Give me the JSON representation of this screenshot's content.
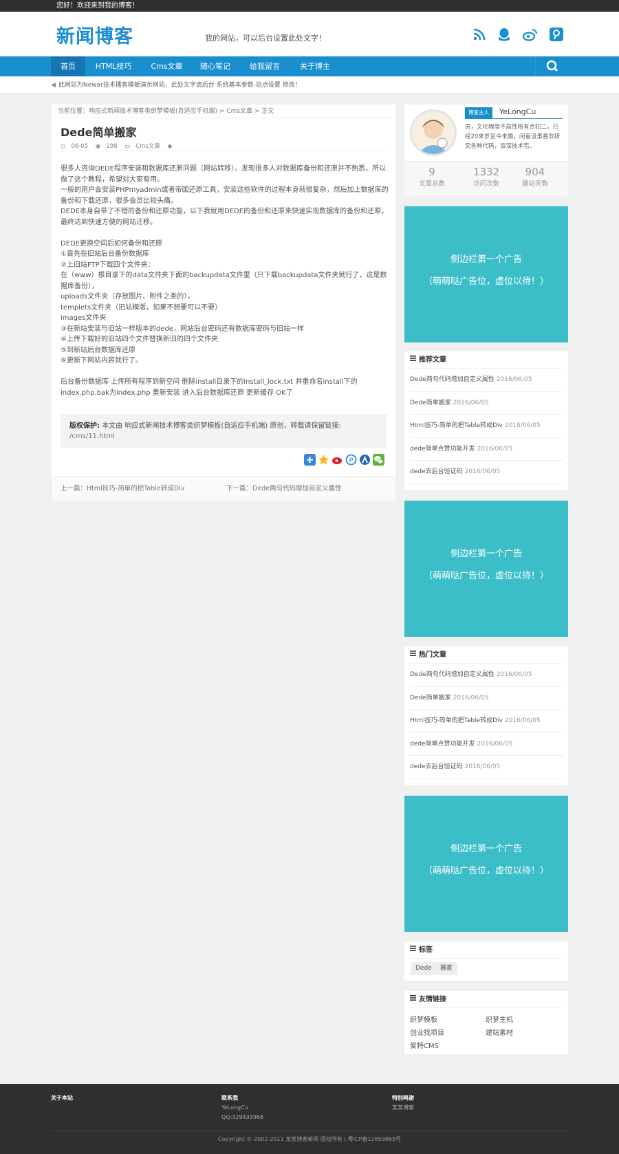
{
  "topbar": {
    "welcome": "您好！欢迎来到我的博客！"
  },
  "header": {
    "logo": "新闻博客",
    "slogan": "我的网站，可以后台设置此处文字！",
    "icons": [
      "rss-icon",
      "qq-icon",
      "weibo-icon",
      "pinterest-icon"
    ]
  },
  "nav": {
    "items": [
      "首页",
      "HTML技巧",
      "Cms文章",
      "随心笔记",
      "给我留言",
      "关于博主"
    ],
    "active": "首页"
  },
  "notice": "此网站为Newar技术播客模板演示网站，此处文字请后台 系统基本参数-站点设置 修改！",
  "article": {
    "breadcrumb": "当前位置：响应式新闻技术博客类织梦模板(自适应手机端) > Cms文章 > 正文",
    "title": "Dede简单搬家",
    "date": "06-05",
    "views": "198",
    "category": "Cms文章",
    "paragraphs": [
      "很多人咨询DEDE程序安装和数据库还原问题（网站转移）。发现很多人对数据库备份和还原并不熟悉，所以做了这个教程，希望对大家有用。",
      "一般的用户会安装PHPmyadmin或者帝国还原工具，安装这些软件的过程本身就很复杂，然后加上数据库的备份和下载还原，很多会员比较头痛。",
      "DEDE本身自带了不错的备份和还原功能，以下我就用DEDE的备份和还原来快速实现数据库的备份和还原，最终达到快速方便的网站迁移。",
      "",
      "DEDE更换空间后如何备份和还原",
      "①首先在旧站后台备份数据库",
      "②上旧站FTP下载四个文件夹：",
      "在（www）根目录下的data文件夹下面的backupdata文件里（只下载backupdata文件夹就行了，这是数据库备份），",
      "uploads文件夹（存放图片、附件之类的），",
      "templets文件夹（旧站模版，如果不想要可以不要）",
      "images文件夹",
      "③在新站安装与旧站一样版本的dede，网站后台密码还有数据库密码与旧站一样",
      "④上传下载好的旧站四个文件替换新旧的四个文件夹",
      "⑤到新站后台数据库还原",
      "⑥更新下网站内容就行了。",
      "",
      "后台备份数据库 上传所有程序到新空间 删除install目录下的install_lock.txt 并重命名install下的index.php.bak为index.php 重新安装 进入后台数据库还原 更新缓存 OK了"
    ],
    "copyright_label": "版权保护:",
    "copyright_text": "本文由 响应式新闻技术博客类织梦模板(自适应手机端) 原创，转载请保留链接:",
    "copyright_link": "/cms/11.html",
    "prev": "上一篇：Html技巧-简单的把Table转成Div",
    "next": "下一篇：Dede两句代码增加自定义属性"
  },
  "profile": {
    "badge": "博客主人",
    "name": "YeLongCu",
    "bio": "男，文化程度不高性格有点犯二，已经20来岁至今未婚，闲着没事喜欢研究各种代码，资深技术宅。",
    "stats": [
      {
        "value": "9",
        "label": "文章总数"
      },
      {
        "value": "1332",
        "label": "访问次数"
      },
      {
        "value": "904",
        "label": "建站天数"
      }
    ]
  },
  "ad": {
    "line1": "侧边栏第一个广告",
    "line2": "（萌萌哒广告位，虚位以待！）"
  },
  "recommended": {
    "title": "推荐文章",
    "items": [
      {
        "text": "Dede两句代码增加自定义属性",
        "date": "2016/06/05"
      },
      {
        "text": "Dede简单搬家",
        "date": "2016/06/05"
      },
      {
        "text": "Html技巧-简单的把Table转成Div",
        "date": "2016/06/05"
      },
      {
        "text": "dede简单点赞功能开发",
        "date": "2016/06/05"
      },
      {
        "text": "dede去后台验证码",
        "date": "2016/06/05"
      }
    ]
  },
  "hot": {
    "title": "热门文章",
    "items": [
      {
        "text": "Dede两句代码增加自定义属性",
        "date": "2016/06/05"
      },
      {
        "text": "Dede简单搬家",
        "date": "2016/06/05"
      },
      {
        "text": "Html技巧-简单的把Table转成Div",
        "date": "2016/06/05"
      },
      {
        "text": "dede简单点赞功能开发",
        "date": "2016/06/05"
      },
      {
        "text": "dede去后台验证码",
        "date": "2016/06/05"
      }
    ]
  },
  "tags": {
    "title": "标签",
    "items": [
      "Dede",
      "搬家"
    ]
  },
  "links": {
    "title": "友情链接",
    "items": [
      "织梦模板",
      "织梦主机",
      "创业找项目",
      "建站素材",
      "爱特CMS"
    ]
  },
  "footer": {
    "about": "关于本站",
    "contact": "联系我",
    "contact_name": "YeLongCu",
    "contact_qq": "QQ:329439966",
    "thanks": "特别鸣谢",
    "thanks_item": "某某博客",
    "copyright": "Copyright © 2002-2011 某某博客新闻 版权所有 | 粤ICP备12659865号"
  },
  "colors": {
    "brand": "#1a8fd0",
    "ad": "#3bbec8",
    "dark": "#2f2f2f"
  }
}
